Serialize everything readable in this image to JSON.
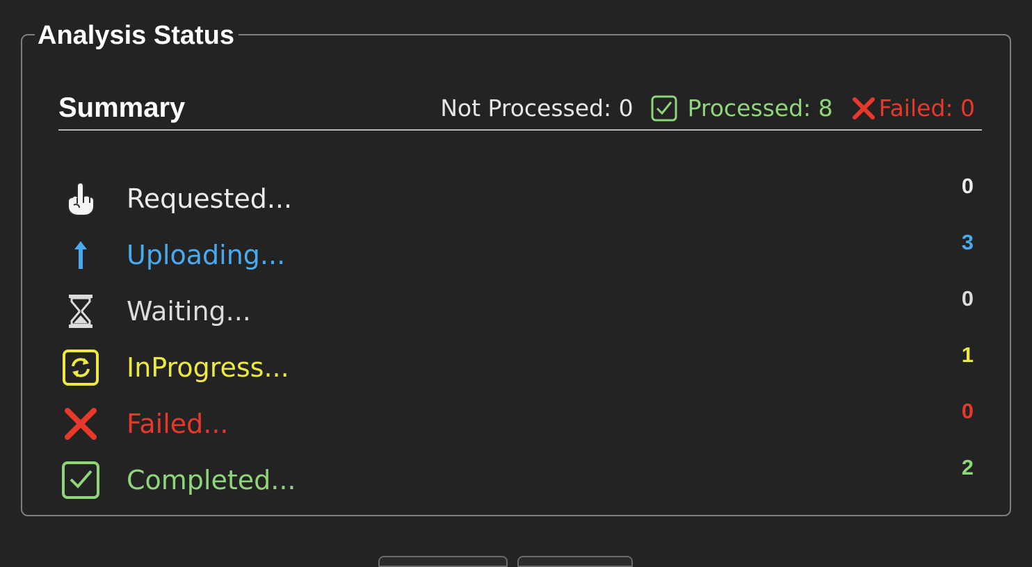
{
  "panel": {
    "title": "Analysis Status"
  },
  "summary": {
    "title": "Summary",
    "not_processed": "Not Processed: 0",
    "processed": "Processed: 8",
    "failed": "Failed: 0"
  },
  "statuses": [
    {
      "label": "Requested...",
      "count": "0",
      "icon": "pointing-hand-icon",
      "color": "#ececec"
    },
    {
      "label": "Uploading...",
      "count": "3",
      "icon": "up-arrow-icon",
      "color": "#4aaaf0"
    },
    {
      "label": "Waiting...",
      "count": "0",
      "icon": "hourglass-icon",
      "color": "#dcdcdc"
    },
    {
      "label": "InProgress...",
      "count": "1",
      "icon": "refresh-icon",
      "color": "#ecea40"
    },
    {
      "label": "Failed...",
      "count": "0",
      "icon": "x-mark-icon",
      "color": "#e8382b"
    },
    {
      "label": "Completed...",
      "count": "2",
      "icon": "checkbox-icon",
      "color": "#8fd67a"
    }
  ],
  "colors": {
    "background": "#232323",
    "border": "#7e7e7e",
    "processed": "#8fd67a",
    "failed": "#e8382b",
    "uploading": "#4aaaf0",
    "in_progress": "#ecea40"
  }
}
